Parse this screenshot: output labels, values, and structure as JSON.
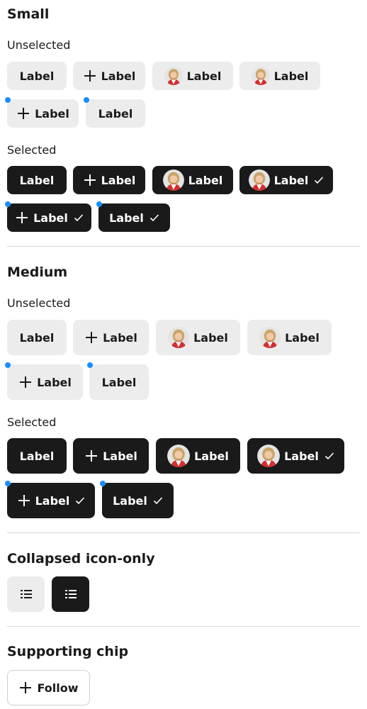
{
  "sections": {
    "small": {
      "title": "Small",
      "unselected": "Unselected",
      "selected": "Selected"
    },
    "medium": {
      "title": "Medium",
      "unselected": "Unselected",
      "selected": "Selected"
    },
    "collapsed": {
      "title": "Collapsed icon-only"
    },
    "supporting": {
      "title": "Supporting chip"
    }
  },
  "chip_label": "Label",
  "follow_label": "Follow",
  "colors": {
    "unselected_bg": "#ececec",
    "selected_bg": "#1a1a1a",
    "text_dark": "#1a1a1a",
    "text_light": "#ffffff",
    "badge_dot": "#1a8cff",
    "divider": "#d6d6d6"
  },
  "icons": {
    "add": "plus-icon",
    "selected": "check-icon",
    "avatar": "avatar",
    "list": "list-icon",
    "badge": "notification-dot"
  }
}
